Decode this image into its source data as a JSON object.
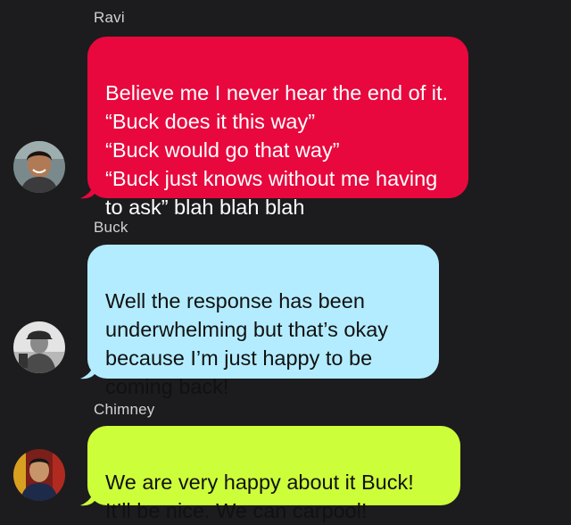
{
  "messages": [
    {
      "sender": "Ravi",
      "text": "Believe me I never hear the end of it. “Buck does it this way”\n“Buck would go that way”\n“Buck just knows without me having to ask” blah blah blah",
      "bubble_color": "#e8083e"
    },
    {
      "sender": "Buck",
      "text": "Well the response has been underwhelming but that’s okay because I’m just happy to be coming back!",
      "bubble_color": "#b3ecff"
    },
    {
      "sender": "Chimney",
      "text": "We are very happy about it Buck! It’ll be nice. We can carpool!",
      "bubble_color": "#cdfe3a"
    }
  ],
  "icons": {
    "avatar_1": "avatar-ravi-photo",
    "avatar_2": "avatar-buck-photo",
    "avatar_3": "avatar-chimney-photo"
  },
  "background_color": "#1c1c1e"
}
